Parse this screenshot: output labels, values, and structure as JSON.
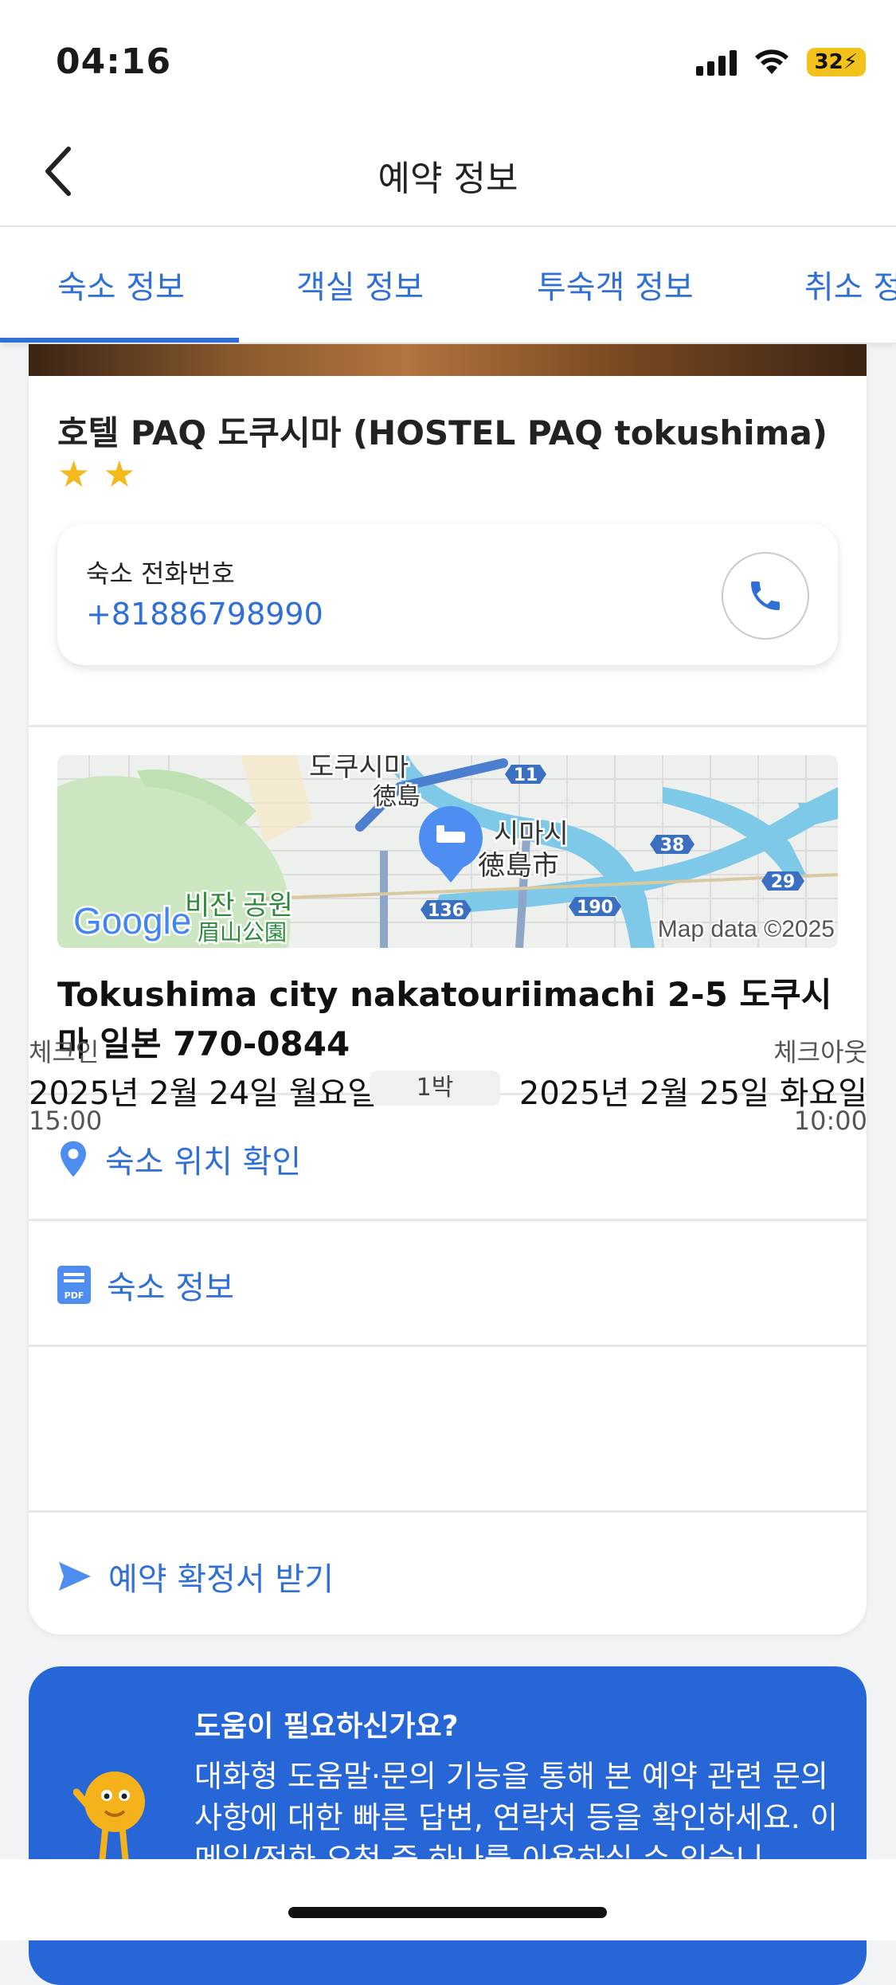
{
  "status_bar": {
    "time": "04:16",
    "battery": "32"
  },
  "header": {
    "title": "예약 정보"
  },
  "tabs": [
    {
      "label": "숙소 정보",
      "active": true
    },
    {
      "label": "객실 정보"
    },
    {
      "label": "투숙객 정보"
    },
    {
      "label": "취소 정"
    }
  ],
  "hotel": {
    "name": "호텔 PAQ 도쿠시마 (HOSTEL PAQ tokushima)",
    "star_rating": 2,
    "stars": [
      "★",
      "★"
    ]
  },
  "phone": {
    "label": "숙소 전화번호",
    "number": "+81886798990"
  },
  "map": {
    "labels": {
      "city_ko": "도쿠시마",
      "station_jp": "徳島",
      "city2_ko": "시마시",
      "city2_jp": "徳島市",
      "park_ko": "비잔 공원",
      "park_jp": "眉山公園"
    },
    "road_numbers": [
      "11",
      "38",
      "29",
      "136",
      "190"
    ],
    "google_logo": "Google",
    "attribution": "Map data ©2025",
    "colors": {
      "water": "#7ec8e8",
      "park": "#cde6c2",
      "route": "#4d7fd1",
      "pin": "#4d8ef0"
    }
  },
  "address": "Tokushima city nakatouriimachi 2-5 도쿠시마 일본 770-0844",
  "links": {
    "location": "숙소 위치 확인",
    "info": "숙소 정보",
    "confirmation": "예약 확정서 받기"
  },
  "stay": {
    "checkin_label": "체크인",
    "checkout_label": "체크아웃",
    "checkin_date": "2025년 2월 24일 월요일",
    "checkout_date": "2025년 2월 25일 화요일",
    "nights": "1박",
    "checkin_time": "15:00",
    "checkout_time": "10:00"
  },
  "help": {
    "title": "도움이 필요하신가요?",
    "body": "대화형 도움말·문의 기능을 통해 본 예약 관련 문의 사항에 대한 빠른 답변, 연락처 등을 확인하세요. 이메일/전화 요청 중 하나를 이용하실 수 있습니"
  },
  "colors": {
    "accent": "#2f6fd6",
    "star": "#f4b91c",
    "help_bg": "#2766d6"
  }
}
